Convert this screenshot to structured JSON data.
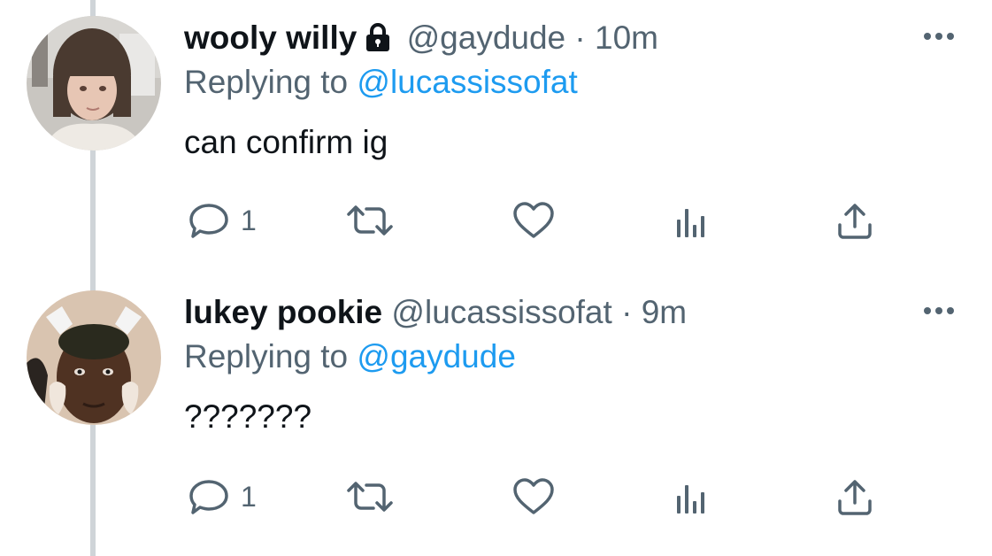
{
  "tweets": [
    {
      "display_name": "wooly willy",
      "protected": true,
      "handle": "@gaydude",
      "separator": "·",
      "time": "10m",
      "replying_prefix": "Replying to",
      "replying_to": "@lucassissofat",
      "text": "can confirm ig",
      "reply_count": "1"
    },
    {
      "display_name": "lukey pookie",
      "protected": false,
      "handle": "@lucassissofat",
      "separator": "·",
      "time": "9m",
      "replying_prefix": "Replying to",
      "replying_to": "@gaydude",
      "text": "???????",
      "reply_count": "1"
    }
  ],
  "icons": {
    "more": "more-horizontal-icon",
    "lock": "lock-icon",
    "reply": "reply-icon",
    "retweet": "retweet-icon",
    "like": "heart-icon",
    "views": "views-chart-icon",
    "share": "share-icon"
  },
  "colors": {
    "text": "#0f1419",
    "secondary": "#536471",
    "link": "#1d9bf0",
    "thread_line": "#cfd4d8"
  }
}
